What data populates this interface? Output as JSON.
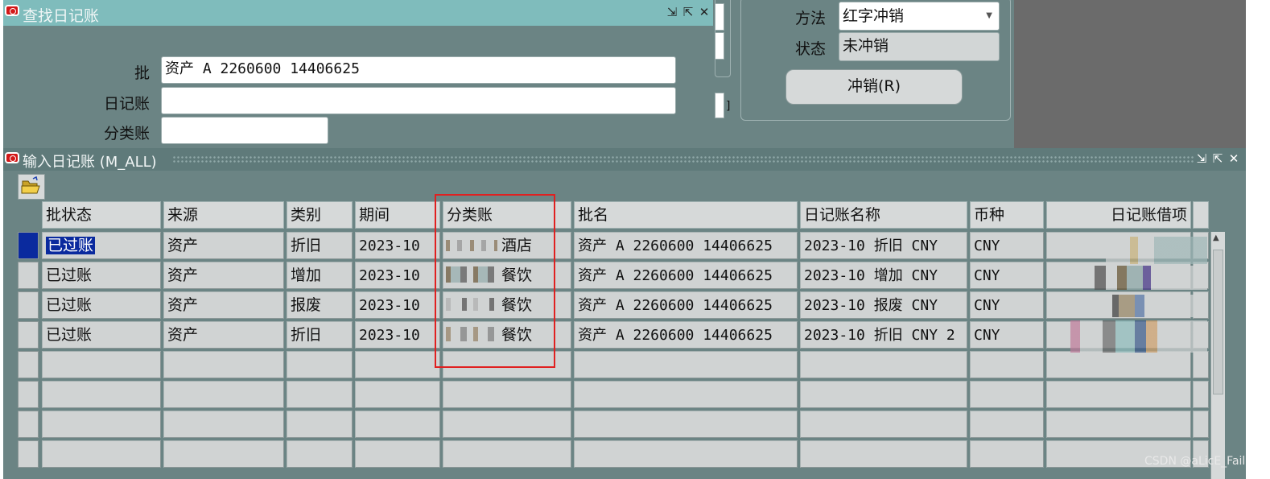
{
  "find_window": {
    "title": "查找日记账",
    "fields": [
      {
        "label": "批",
        "value": "资产 A 2260600 14406625"
      },
      {
        "label": "日记账",
        "value": ""
      },
      {
        "label": "分类账",
        "value": ""
      }
    ]
  },
  "reverse_panel": {
    "method_label": "方法",
    "method_value": "红字冲销",
    "status_label": "状态",
    "status_value": "未冲销",
    "reverse_button": "冲销(R)"
  },
  "journal_window": {
    "title": "输入日记账 (M_ALL)",
    "columns": [
      "批状态",
      "来源",
      "类别",
      "期间",
      "分类账",
      "批名",
      "日记账名称",
      "币种",
      "日记账借项"
    ],
    "rows": [
      [
        "已过账",
        "资产",
        "折旧",
        "2023-10",
        "酒店",
        "资产 A 2260600 14406625",
        "2023-10 折旧 CNY",
        "CNY",
        ""
      ],
      [
        "已过账",
        "资产",
        "增加",
        "2023-10",
        "餐饮",
        "资产 A 2260600 14406625",
        "2023-10 增加 CNY",
        "CNY",
        ""
      ],
      [
        "已过账",
        "资产",
        "报废",
        "2023-10",
        "餐饮",
        "资产 A 2260600 14406625",
        "2023-10 报废 CNY",
        "CNY",
        ""
      ],
      [
        "已过账",
        "资产",
        "折旧",
        "2023-10",
        "餐饮",
        "资产 A 2260600 14406625",
        "2023-10 折旧 CNY 2",
        "CNY",
        ""
      ]
    ]
  },
  "watermark": "CSDN @aLicE_Fail",
  "colors": {
    "teal_bg": "#6b8484",
    "titlebar_find": "#7fbcbc",
    "titlebar_journal": "#5f7a7a",
    "highlight_red": "#e02020",
    "selection_blue": "#0a2a9e"
  },
  "icons": [
    "oracle-icon",
    "minimize-icon",
    "maximize-icon",
    "close-icon",
    "folder-open-icon",
    "dropdown-arrow-icon"
  ]
}
